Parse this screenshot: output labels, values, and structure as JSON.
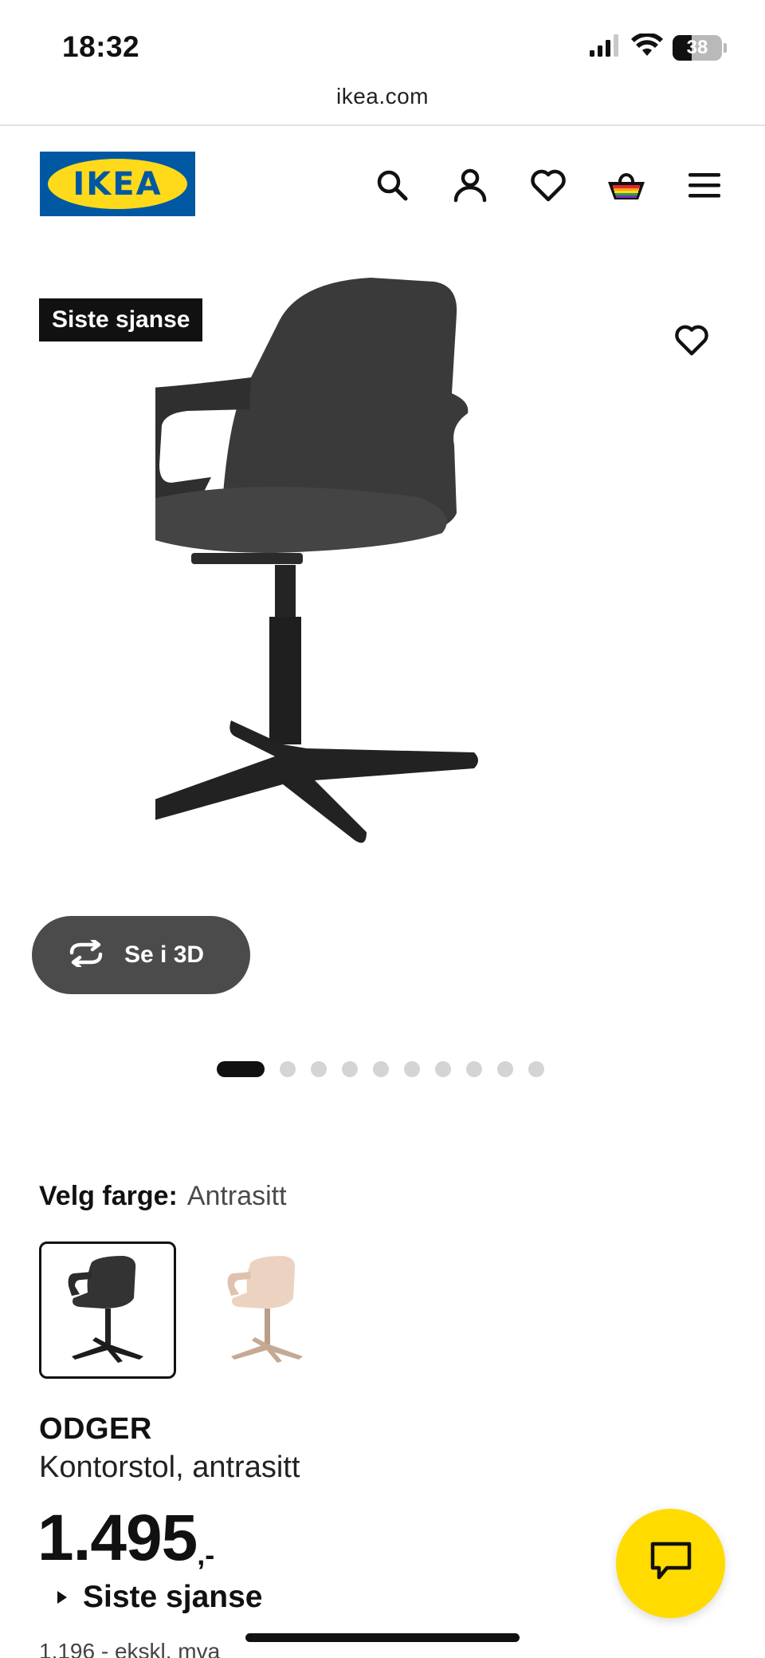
{
  "status_bar": {
    "time": "18:32",
    "battery": "38",
    "battery_level": 0.38,
    "icons": [
      "signal-icon",
      "wifi-icon",
      "battery-icon"
    ]
  },
  "browser": {
    "url": "ikea.com"
  },
  "header": {
    "logo_text": "IKEA",
    "brand_colors": {
      "blue": "#0058a3",
      "yellow": "#ffda1a"
    },
    "icons": [
      "search-icon",
      "account-icon",
      "wishlist-icon",
      "cart-icon",
      "menu-icon"
    ]
  },
  "gallery": {
    "badge": "Siste sjanse",
    "view_3d_label": "Se i 3D",
    "image_count": 10,
    "active_index": 0
  },
  "color": {
    "label": "Velg farge:",
    "value": "Antrasitt",
    "options": [
      {
        "name": "Antrasitt",
        "color": "#333333",
        "selected": true
      },
      {
        "name": "Beige",
        "color": "#e8cdb8",
        "selected": false
      }
    ]
  },
  "product": {
    "name": "ODGER",
    "description": "Kontorstol, antrasitt",
    "price": "1.495",
    "price_suffix": ",-",
    "offer_label": "Siste sjanse",
    "sub_price": "1.196 - ekskl. mva"
  },
  "chat": {
    "accent": "#ffdb00"
  }
}
